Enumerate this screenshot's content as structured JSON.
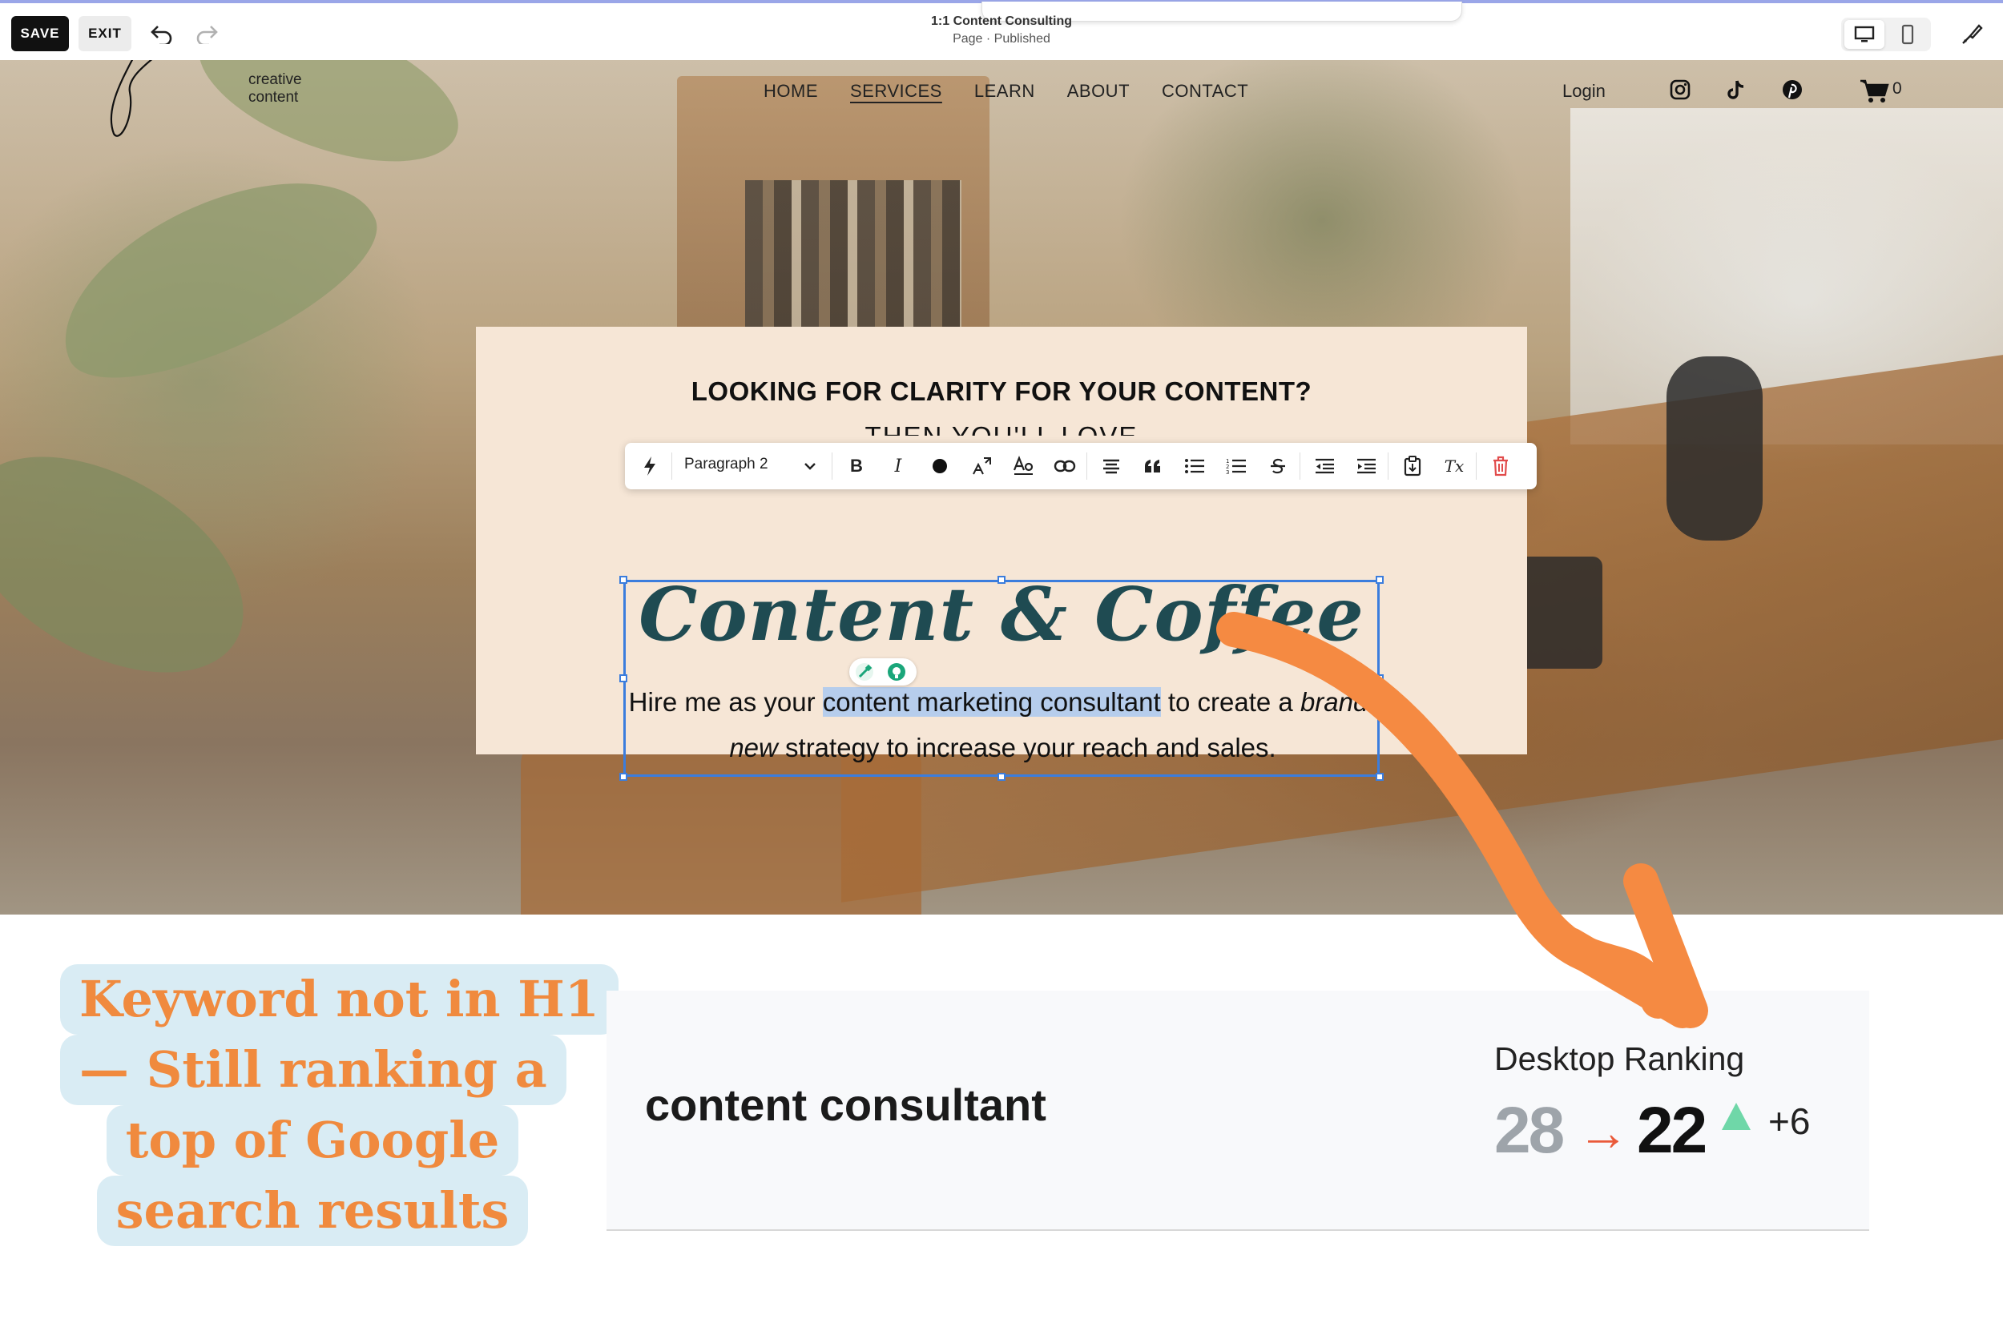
{
  "editor": {
    "save_label": "SAVE",
    "exit_label": "EXIT",
    "page_title": "1:1 Content Consulting",
    "page_status": "Page · Published"
  },
  "site": {
    "logo_text": "creative content",
    "nav": [
      "HOME",
      "SERVICES",
      "LEARN",
      "ABOUT",
      "CONTACT"
    ],
    "active_nav": "SERVICES",
    "login_label": "Login",
    "cart_count": "0"
  },
  "card": {
    "heading": "LOOKING FOR CLARITY FOR YOUR CONTENT?",
    "subheading": "THEN YOU'LL LOVE",
    "title": "Content & Coffee",
    "body_pre": "Hire me as your ",
    "body_highlight": "content marketing consultant",
    "body_mid": " to create a ",
    "body_italic": "brand-new",
    "body_post": " strategy to increase your reach and sales."
  },
  "toolbar": {
    "style_select": "Paragraph 2",
    "bold": "B",
    "italic": "I",
    "clear_format": "Tx"
  },
  "callout": {
    "lines": [
      "Keyword not in H1",
      "— Still ranking a",
      "top of Google",
      "search results"
    ]
  },
  "ranking": {
    "keyword": "content consultant",
    "label": "Desktop Ranking",
    "old_rank": "28",
    "arrow": "→",
    "new_rank": "22",
    "delta": "+6"
  },
  "colors": {
    "accent_orange": "#f58a42",
    "selection_blue": "#3b7ddd",
    "title_teal": "#1f4b52",
    "callout_bg": "#d9ecf4",
    "rank_up_green": "#6fd7a8"
  },
  "icons": {
    "undo": "undo-icon",
    "redo": "redo-icon",
    "desktop": "desktop-icon",
    "mobile": "mobile-icon",
    "design": "paintbrush-icon",
    "instagram": "instagram-icon",
    "tiktok": "tiktok-icon",
    "pinterest": "pinterest-icon",
    "cart": "cart-icon"
  }
}
